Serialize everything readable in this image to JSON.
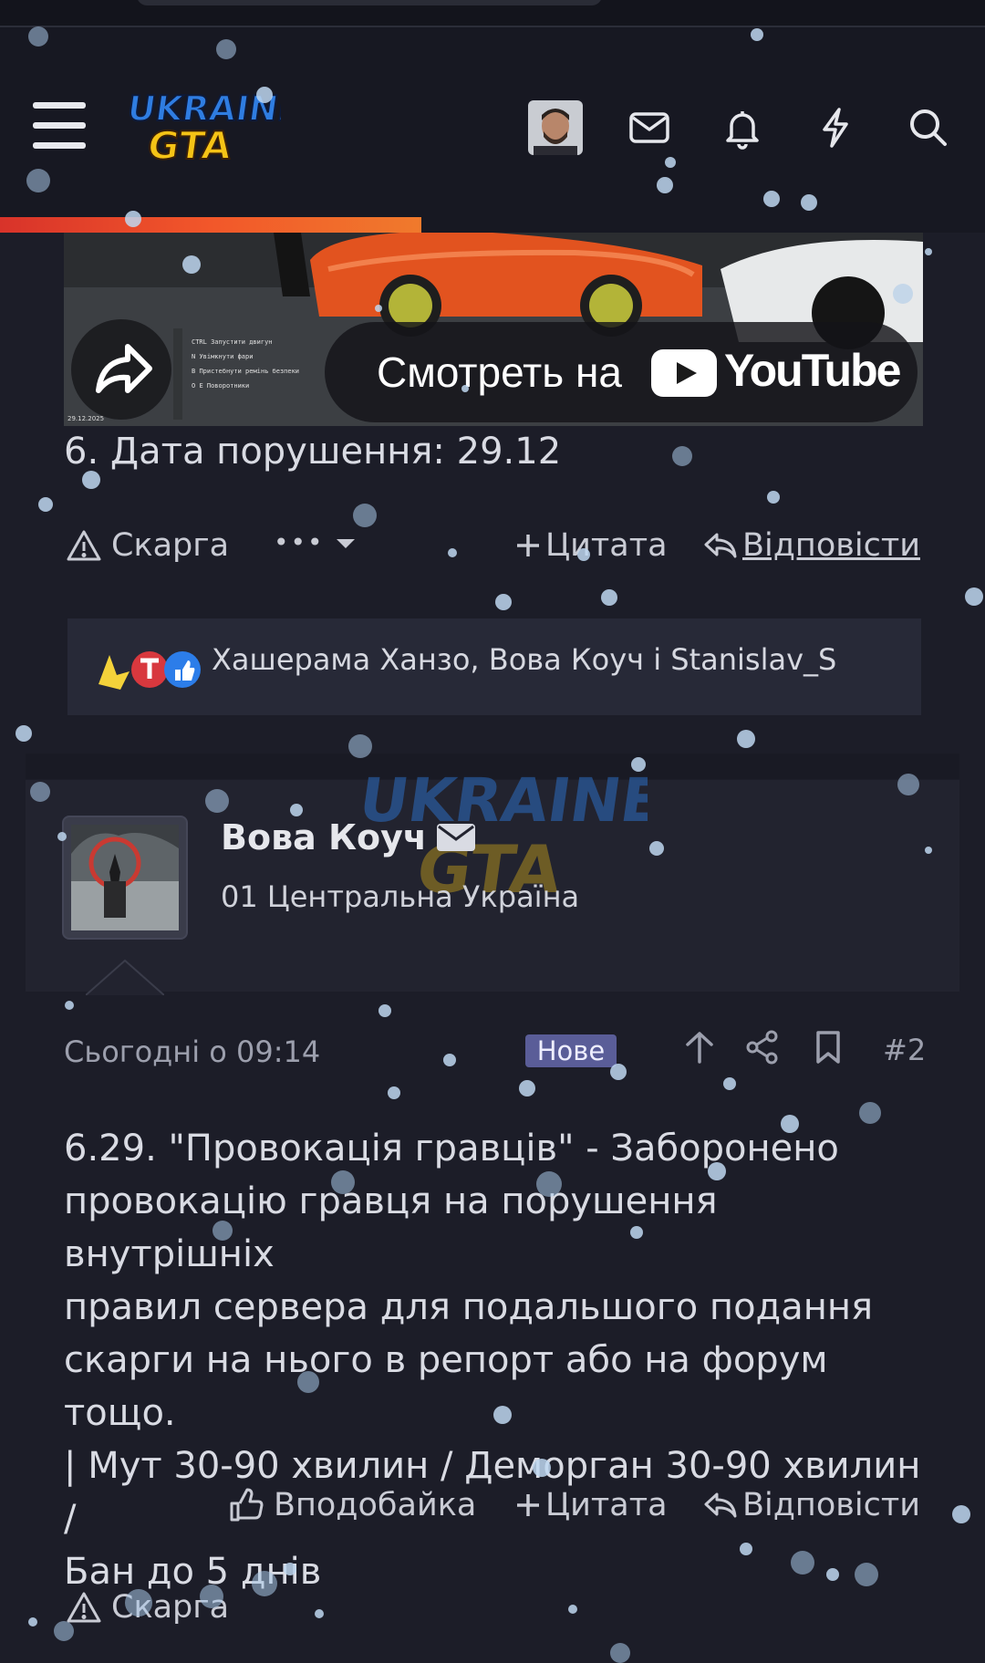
{
  "header": {
    "logo_line1": "UKRAINE",
    "logo_line2": "GTA",
    "icons": [
      "menu-icon",
      "avatar",
      "mail-icon",
      "bell-icon",
      "lightning-icon",
      "search-icon"
    ]
  },
  "page_progress": 0.43,
  "video": {
    "watch_label": "Смотреть на",
    "platform": "YouTube",
    "overlay_hint_keys": [
      "CTRL",
      "N",
      "B",
      "O",
      "E"
    ],
    "overlay_hints": [
      "Запустити двигун",
      "Увімкнути фари",
      "Пристебнути ремінь безпеки",
      "Поворотники"
    ],
    "timestamp_overlay": "29.12.2025"
  },
  "previous_post": {
    "last_line": "6. Дата порушення: 29.12",
    "actions": {
      "report": "Скарга",
      "more": "•••",
      "quote": "Цитата",
      "reply": "Відповісти"
    },
    "reactions_text": "Хашерама Ханзо, Вова Коуч і Stanislav_S"
  },
  "post": {
    "author": "Вова Коуч",
    "server": "01 Центральна Україна",
    "date": "Сьогодні о 09:14",
    "badge": "Нове",
    "number": "#2",
    "body": [
      "6.29. \"Провокація гравців\" - Заборонено",
      "провокацію гравця на порушення внутрішніх",
      "правил сервера для подальшого подання",
      "скарги на нього в репорт або на форум тощо.",
      "| Мут 30-90 хвилин / Деморган 30-90 хвилин /",
      "Бан до 5 днів"
    ],
    "actions": {
      "like": "Вподобайка",
      "quote": "Цитата",
      "reply": "Відповісти",
      "report": "Скарга"
    }
  },
  "colors": {
    "background": "#1c1d28",
    "header": "#171822",
    "progress": "#f2572a",
    "badge": "#5a5d98",
    "snow": "#a9c6e8"
  }
}
